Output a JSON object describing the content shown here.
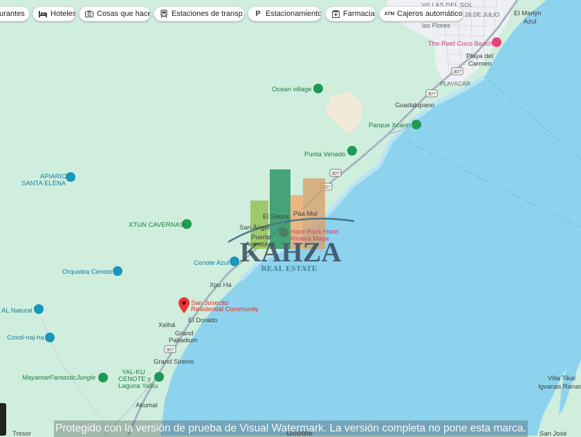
{
  "chips": [
    {
      "label": "urantes",
      "icon": "restaurant-icon"
    },
    {
      "label": "Hoteles",
      "icon": "bed-icon"
    },
    {
      "label": "Cosas que hacer",
      "icon": "camera-icon"
    },
    {
      "label": "Estaciones de transp…",
      "icon": "transit-icon"
    },
    {
      "label": "Estacionamientos",
      "icon": "parking-icon"
    },
    {
      "label": "Farmacias",
      "icon": "pharmacy-icon"
    },
    {
      "label": "Cajeros automáticos",
      "icon": "atm-icon"
    }
  ],
  "place_labels": {
    "villas_del_sol": "VILLAS DEL SOL",
    "veintiocho_julio": "28 DE JULIO",
    "las_flores": "las Flores",
    "el_marlyn": "El Marlyn",
    "azul": "Azul",
    "reef_coco_beach": "The Reef Coco Beach",
    "playa_del": "Playa del",
    "carmen": "Carmen",
    "playacar": "PLAYACAR",
    "ocean_village": "Ocean village",
    "guadalupano": "Guadalupano",
    "parque_xcaret": "Parque Xcaret",
    "punta_venado": "Punta Venado",
    "apiario": "APIARIO",
    "santa_elena": "SANTA ELENA",
    "xtun_cavernas": "XTUN CAVERNAS",
    "el_sauce": "El Sauce",
    "paa_mul": "Paa Mul",
    "san_angel": "San Ángel",
    "hard_rock_1": "Hard Rock Hotel",
    "hard_rock_2": "Riviera Maya",
    "puerto": "Puerto",
    "aventuras": "Aventuras",
    "cenote_azul": "Cenote Azul",
    "orquidea_cenote": "Orquidea Cenote",
    "xpu_ha": "Xpu Ha",
    "al_natural": "AL Natural",
    "san_josecito_1": "San Josecito",
    "san_josecito_2": "Residential Community",
    "el_dorado": "El Dorado",
    "xelha": "Xelhá",
    "coxol": "Coxol-naj-ha",
    "grand": "Grand",
    "palladium": "Palladium",
    "grand_sirenis": "Grand Sirenis",
    "mayamar": "MayamarFantasticJungle",
    "yalku_1": "YAL-KU",
    "yalku_2": "CENOTE y",
    "yalku_3": "Laguna Yalku",
    "akumal": "Akumal",
    "villa_tikal": "Villa Tikal",
    "igvanas_ranas": "Igvanas Ranas",
    "san_jose": "San José",
    "tresor": "Tresor",
    "google": "Google"
  },
  "route_shields": [
    "307",
    "307",
    "307",
    "307",
    "307"
  ],
  "logo": {
    "main": "KAHZA",
    "sub": "REAL ESTATE"
  },
  "watermark": "Protegido con la versión de prueba de Visual Watermark. La versión completa no pone esta marca.",
  "colors": {
    "land": "#cfeedd",
    "sea": "#8dd3ee",
    "road": "#a7b3c0",
    "green_poi": "#1e9a52",
    "blue_poi": "#1a95bd",
    "pink_poi": "#e0457b",
    "red_pin": "#e53935"
  }
}
